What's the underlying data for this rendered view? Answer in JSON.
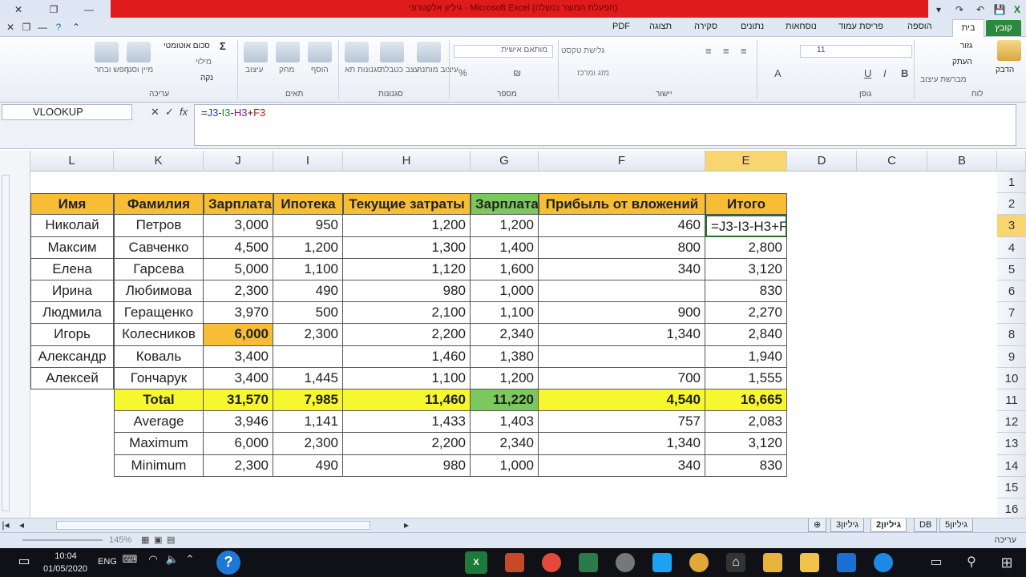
{
  "window": {
    "title": "גיליון אלקטרוני - Microsoft Excel (הפעלת המוצר נכשלה)",
    "quick_access": [
      "save-icon",
      "undo-icon",
      "redo-icon"
    ]
  },
  "ribbon": {
    "tabs": [
      "PDF",
      "תצוגה",
      "סקירה",
      "נתונים",
      "נוסחאות",
      "פריסת עמוד",
      "הוספה"
    ],
    "active_tab": "בית",
    "file_tab": "קובץ",
    "groups": {
      "clipboard": {
        "label": "לוח",
        "paste": "הדבק",
        "cut": "גזור",
        "copy": "העתק",
        "format_painter": "מברשת עיצוב"
      },
      "font": {
        "label": "גופן",
        "size": "11"
      },
      "alignment": {
        "label": "יישור",
        "wrap": "גלישת טקסט",
        "merge": "מזג ומרכז"
      },
      "number": {
        "label": "מספר",
        "format": "מותאם אישית"
      },
      "styles": {
        "label": "סגנונות",
        "cond": "עיצוב מותנה",
        "table": "עצב כטבלה",
        "cell": "סגנונות תא"
      },
      "cells": {
        "label": "תאים",
        "insert": "הוסף",
        "delete": "מחק",
        "format": "עיצוב"
      },
      "editing": {
        "label": "עריכה",
        "autosum": "סכום אוטומטי",
        "fill": "מילוי",
        "clear": "נקה",
        "sort": "מיין וסנן",
        "find": "חפש ובחר"
      }
    }
  },
  "formula_bar": {
    "name_box": "VLOOKUP",
    "fx": "fx",
    "formula_parts": [
      "=",
      "J3",
      "-",
      "I3",
      "-",
      "H3",
      "+",
      "F3"
    ]
  },
  "grid": {
    "columns": [
      "L",
      "K",
      "J",
      "I",
      "H",
      "G",
      "F",
      "E",
      "D",
      "C",
      "B"
    ],
    "selected_column": "E",
    "rows": [
      "1",
      "2",
      "3",
      "4",
      "5",
      "6",
      "7",
      "8",
      "9",
      "10",
      "11",
      "12",
      "13",
      "14",
      "15",
      "16"
    ],
    "selected_row": "3",
    "headers": [
      "Имя",
      "Фамилия",
      "Зарплата",
      "Ипотека",
      "Текущие затраты",
      "Зарплата",
      "Прибыль от вложений",
      "Итого"
    ],
    "data": [
      [
        "Николай",
        "Петров",
        "3,000",
        "950",
        "1,200",
        "1,200",
        "460",
        "=J3-I3-H3+F3"
      ],
      [
        "Максим",
        "Савченко",
        "4,500",
        "1,200",
        "1,300",
        "1,400",
        "800",
        "2,800"
      ],
      [
        "Елена",
        "Гарсева",
        "5,000",
        "1,100",
        "1,120",
        "1,600",
        "340",
        "3,120"
      ],
      [
        "Ирина",
        "Любимова",
        "2,300",
        "490",
        "980",
        "1,000",
        "",
        "830"
      ],
      [
        "Людмила",
        "Геращенко",
        "3,970",
        "500",
        "2,100",
        "1,100",
        "900",
        "2,270"
      ],
      [
        "Игорь",
        "Колесников",
        "6,000",
        "2,300",
        "2,200",
        "2,340",
        "1,340",
        "2,840"
      ],
      [
        "Александр",
        "Коваль",
        "3,400",
        "",
        "1,460",
        "1,380",
        "",
        "1,940"
      ],
      [
        "Алексей",
        "Гончарук",
        "3,400",
        "1,445",
        "1,100",
        "1,200",
        "700",
        "1,555"
      ]
    ],
    "summary": [
      [
        "Total",
        "31,570",
        "7,985",
        "11,460",
        "11,220",
        "4,540",
        "16,665"
      ],
      [
        "Average",
        "3,946",
        "1,141",
        "1,433",
        "1,403",
        "757",
        "2,083"
      ],
      [
        "Maximum",
        "6,000",
        "2,300",
        "2,200",
        "2,340",
        "1,340",
        "3,120"
      ],
      [
        "Minimum",
        "2,300",
        "490",
        "980",
        "1,000",
        "340",
        "830"
      ]
    ]
  },
  "sheets": {
    "tabs": [
      "גיליון3",
      "גיליון2",
      "DB",
      "גיליון5"
    ],
    "active": "גיליון2"
  },
  "status": {
    "mode": "עריכה",
    "zoom": "145%"
  },
  "taskbar": {
    "time": "10:04",
    "date": "01/05/2020",
    "lang": "ENG"
  },
  "colors": {
    "header_orange": "#f6bd35",
    "total_yellow": "#f7f730",
    "green": "#7cc85e",
    "excel_green": "#2a8a3c"
  }
}
